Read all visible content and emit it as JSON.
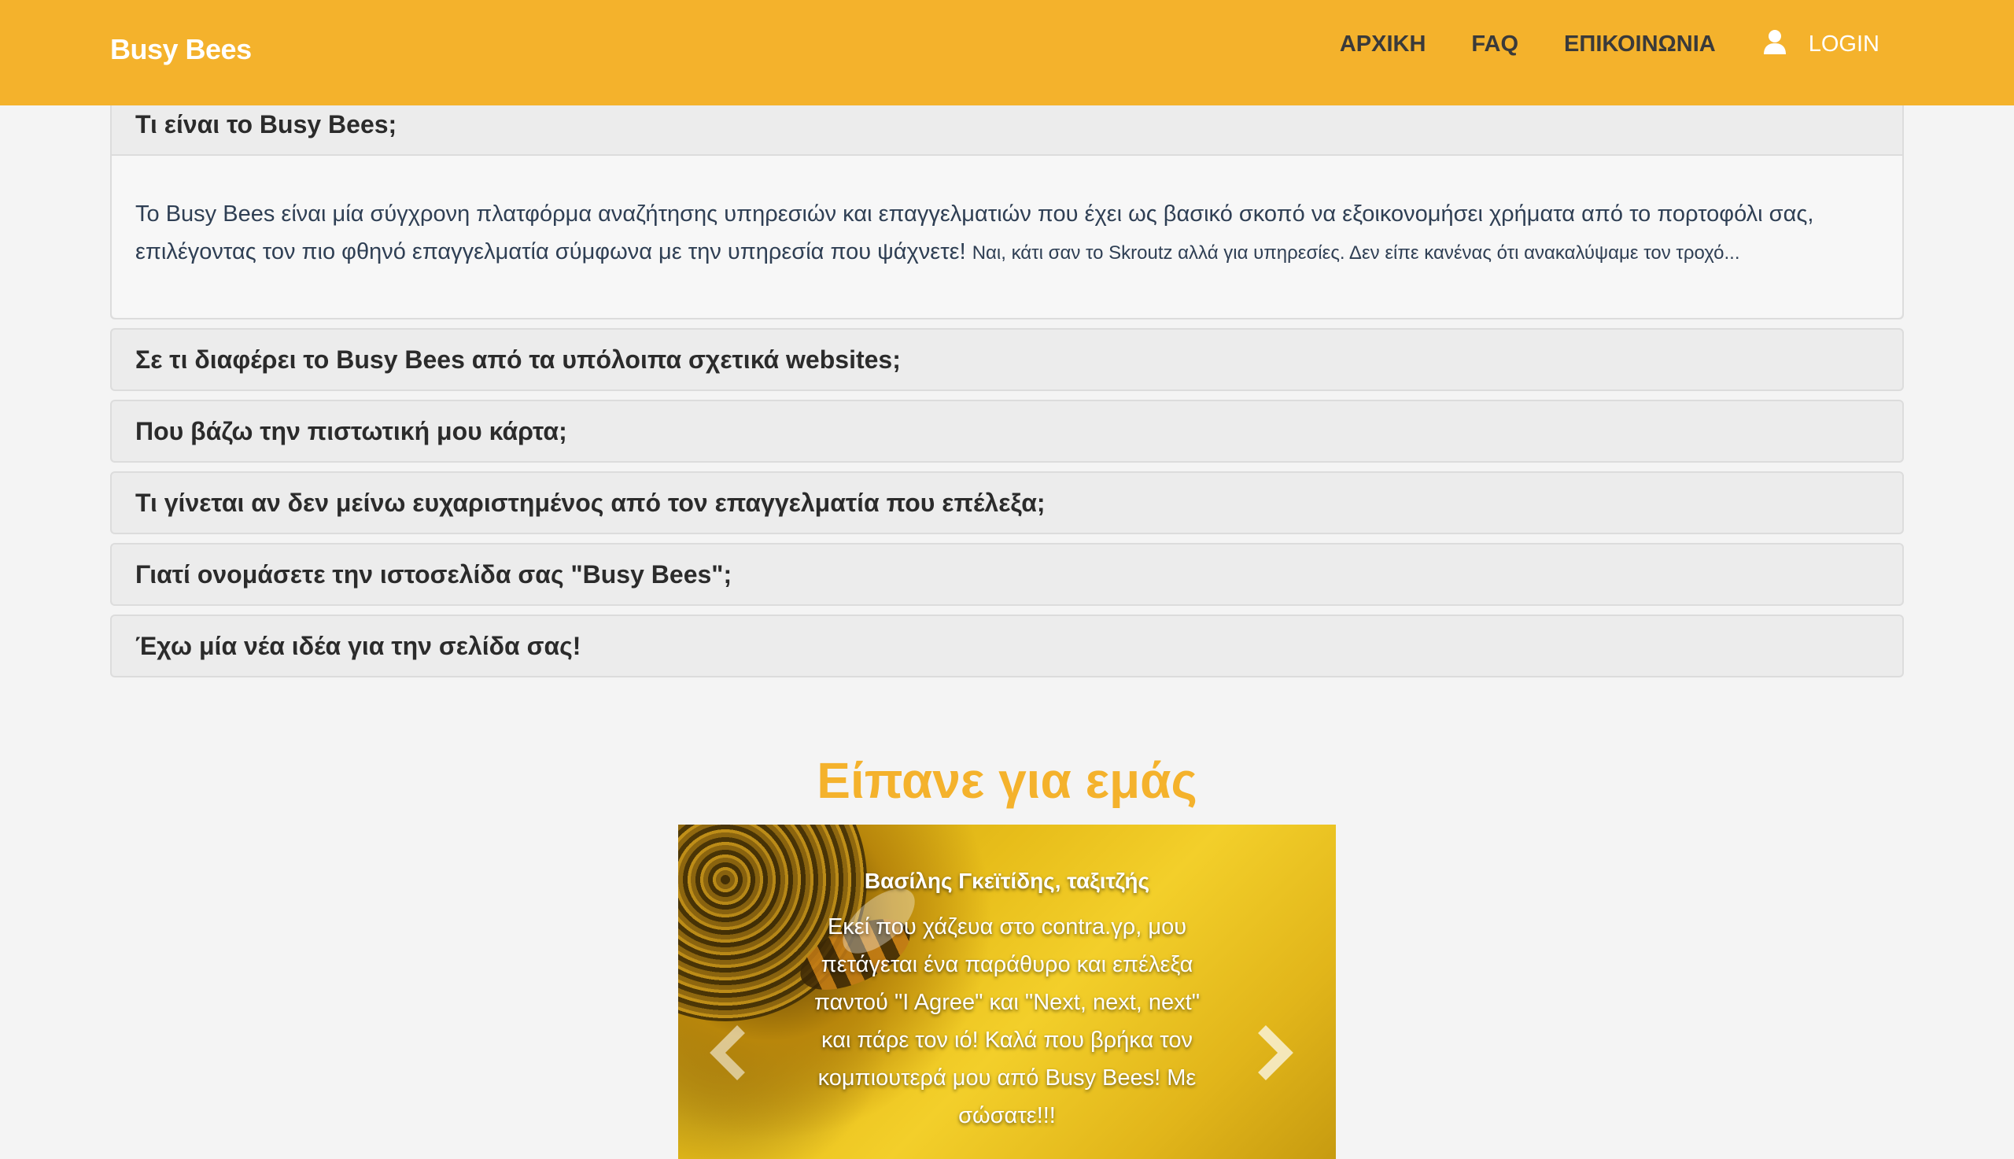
{
  "nav": {
    "brand": "Busy Bees",
    "links": [
      "ΑΡΧΙΚΗ",
      "FAQ",
      "ΕΠΙΚΟΙΝΩΝΙΑ"
    ],
    "login": "LOGIN",
    "login_icon": "user-icon"
  },
  "faq": {
    "items": [
      {
        "question": "Τι είναι το Busy Bees;",
        "answer": "Το Busy Bees είναι μία σύγχρονη πλατφόρμα αναζήτησης υπηρεσιών και επαγγελματιών που έχει ως βασικό σκοπό να εξοικονομήσει χρήματα από το πορτοφόλι σας, επιλέγοντας τον πιο φθηνό επαγγελματία σύμφωνα με την υπηρεσία που ψάχνετε!",
        "answer_small": "Ναι, κάτι σαν το Skroutz αλλά για υπηρεσίες. Δεν είπε κανένας ότι ανακαλύψαμε τον τροχό..."
      },
      {
        "question": "Σε τι διαφέρει το Busy Bees από τα υπόλοιπα σχετικά websites;"
      },
      {
        "question": "Που βάζω την πιστωτική μου κάρτα;"
      },
      {
        "question": "Τι γίνεται αν δεν μείνω ευχαριστημένος από τον επαγγελματία που επέλεξα;"
      },
      {
        "question": "Γιατί ονομάσετε την ιστοσελίδα σας \"Busy Bees\";"
      },
      {
        "question": "Έχω μία νέα ιδέα για την σελίδα σας!"
      }
    ]
  },
  "testimonials": {
    "title": "Είπανε για εμάς",
    "slide": {
      "author": "Βασίλης Γκεϊτίδης, ταξιτζής",
      "quote": "Εκεί που χάζευα στο contra.γρ, μου πετάγεται ένα παράθυρο και επέλεξα παντού \"I Agree\" και \"Next, next, next\" και πάρε τον ιό! Καλά που βρήκα τον κομπιουτερά μου από Busy Bees! Με σώσατε!!!"
    },
    "prev_icon": "chevron-left-icon",
    "next_icon": "chevron-right-icon"
  },
  "colors": {
    "accent": "#f4b22c",
    "panel": "#ececec",
    "text": "#2d3e50"
  }
}
